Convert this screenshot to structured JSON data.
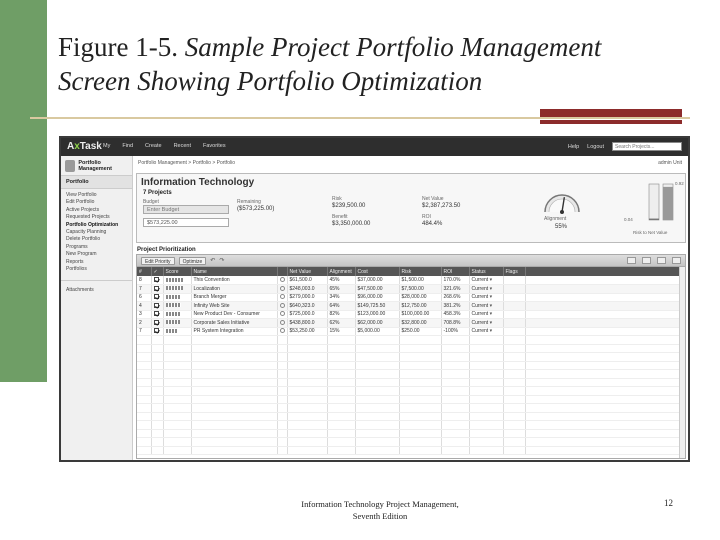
{
  "slide": {
    "title_normal": "Figure 1-5.",
    "title_italic_1": "Sample Project Portfolio Management",
    "title_italic_2": "Screen Showing Portfolio Optimization",
    "footer_line1": "Information Technology Project Management,",
    "footer_line2": "Seventh Edition",
    "page_number": "12"
  },
  "app": {
    "logo_a": "A",
    "logo_x": "x",
    "logo_b": "Task",
    "nav": [
      "My",
      "Find",
      "Create",
      "Recent",
      "Favorites"
    ],
    "help": "Help",
    "logout": "Logout",
    "search_placeholder": "Search Projects...",
    "user": "admin Unit",
    "breadcrumb": "Portfolio Management > Portfolio > Portfolio"
  },
  "sidebar": {
    "header": "Portfolio Management",
    "section": "Portfolio",
    "items": [
      "View Portfolio",
      "Edit Portfolio",
      "Active Projects",
      "Requested Projects",
      "Portfolio Optimization",
      "Capacity Planning",
      "Delete Portfolio",
      "Programs",
      "New Program",
      "Reports",
      "Portfolios"
    ],
    "active_index": 4,
    "attachments": "Attachments"
  },
  "summary": {
    "title": "Information Technology",
    "project_count": "7 Projects",
    "budget_label": "Budget",
    "budget_input": "Enter Budget",
    "remaining_label": "Remaining",
    "remaining_value": "($573,225.00)",
    "budget_value": "$573,225.00",
    "risk_label": "Risk",
    "risk_value": "$239,500.00",
    "benefit_label": "Benefit",
    "benefit_value": "$3,350,000.00",
    "net_value_label": "Net Value",
    "net_value": "$2,387,273.50",
    "roi_label": "ROI",
    "roi_value": "484.4%",
    "alignment_label": "Alignment",
    "alignment_value": "55%",
    "alignment_fraction": 0.55,
    "bar_top_value": "0.92",
    "bar_left_value": "0.04",
    "bar_caption": "Risk to Net Value",
    "bar_risk_fraction": 0.04,
    "bar_value_fraction": 0.92
  },
  "prioritization": {
    "title": "Project Prioritization",
    "toolbar": {
      "edit_priority": "Edit Priority",
      "optimize": "Optimize"
    },
    "columns": [
      "#",
      "✓",
      "Score",
      "Name",
      "",
      "Net Value",
      "Alignment",
      "Cost",
      "Risk",
      "ROI",
      "Status",
      "Flags"
    ],
    "rows": [
      {
        "num": "8",
        "score": 0.6,
        "name": "This Convention",
        "net": "$61,500.0",
        "align": "45%",
        "cost": "$37,000.00",
        "risk": "$1,500.00",
        "roi": "170.0%",
        "status": "Current"
      },
      {
        "num": "7",
        "score": 0.55,
        "name": "Localization",
        "net": "$248,003.0",
        "align": "65%",
        "cost": "$47,500.00",
        "risk": "$7,500.00",
        "roi": "321.6%",
        "status": "Current"
      },
      {
        "num": "6",
        "score": 0.5,
        "name": "Branch Merger",
        "net": "$279,000.0",
        "align": "34%",
        "cost": "$96,000.00",
        "risk": "$28,000.00",
        "roi": "268.6%",
        "status": "Current"
      },
      {
        "num": "4",
        "score": 0.5,
        "name": "Infinity Web Site",
        "net": "$640,323.0",
        "align": "64%",
        "cost": "$149,725.50",
        "risk": "$12,750.00",
        "roi": "381.2%",
        "status": "Current"
      },
      {
        "num": "3",
        "score": 0.45,
        "name": "New Product Dev - Consumer",
        "net": "$725,000.0",
        "align": "82%",
        "cost": "$123,000.00",
        "risk": "$100,000.00",
        "roi": "458.3%",
        "status": "Current"
      },
      {
        "num": "2",
        "score": 0.45,
        "name": "Corporate Sales Initiative",
        "net": "$438,800.0",
        "align": "62%",
        "cost": "$62,000.00",
        "risk": "$32,800.00",
        "roi": "708.8%",
        "status": "Current"
      },
      {
        "num": "7",
        "score": 0.4,
        "name": "PR System Integration",
        "net": "$53,250.00",
        "align": "15%",
        "cost": "$5,000.00",
        "risk": "$250.00",
        "roi": "-100%",
        "status": "Current"
      }
    ]
  }
}
